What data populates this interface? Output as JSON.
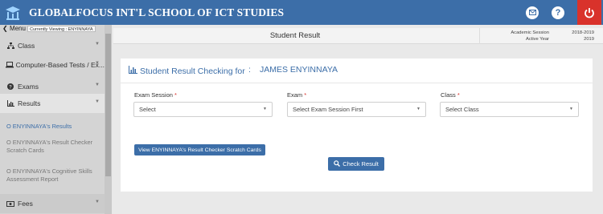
{
  "header": {
    "school_name": "GLOBALFOCUS INT'L SCHOOL OF ICT STUDIES",
    "logo_icon": "graduation-cap-icon",
    "icons": [
      "mail-icon",
      "help-icon",
      "power-icon"
    ],
    "help_glyph": "?",
    "brand_color": "#3c6ea8",
    "power_color": "#d9322b"
  },
  "sidebar": {
    "menu_label": "Menu",
    "viewing_label": "Currently Viewing : ENYINNAYA",
    "items": [
      {
        "label": "Class",
        "icon": "sitemap-icon"
      },
      {
        "label": "Computer-Based Tests / Ex...",
        "icon": "laptop-icon"
      },
      {
        "label": "Exams",
        "icon": "question-circle-icon"
      },
      {
        "label": "Results",
        "icon": "bar-chart-icon"
      },
      {
        "label": "Fees",
        "icon": "money-icon"
      }
    ],
    "sub_links": [
      "O ENYINNAYA's Results",
      "O ENYINNAYA's Result Checker Scratch Cards",
      "O ENYINNAYA's Cognitive Skills Assessment Report"
    ]
  },
  "page": {
    "title": "Student Result",
    "academic_session_label": "Academic Session",
    "academic_session_value": "2018-2019",
    "active_year_label": "Active Year",
    "active_year_value": "2019"
  },
  "card": {
    "title": "Student Result Checking for",
    "separator": ":",
    "student_name": "JAMES ENYINNAYA",
    "fields": [
      {
        "label": "Exam Session",
        "required": "*",
        "value": "Select"
      },
      {
        "label": "Exam",
        "required": "*",
        "value": "Select Exam Session First"
      },
      {
        "label": "Class",
        "required": "*",
        "value": "Select Class"
      }
    ],
    "scratch_button": "View ENYINNAYA's Result Checker Scratch Cards",
    "check_button": "Check Result"
  }
}
